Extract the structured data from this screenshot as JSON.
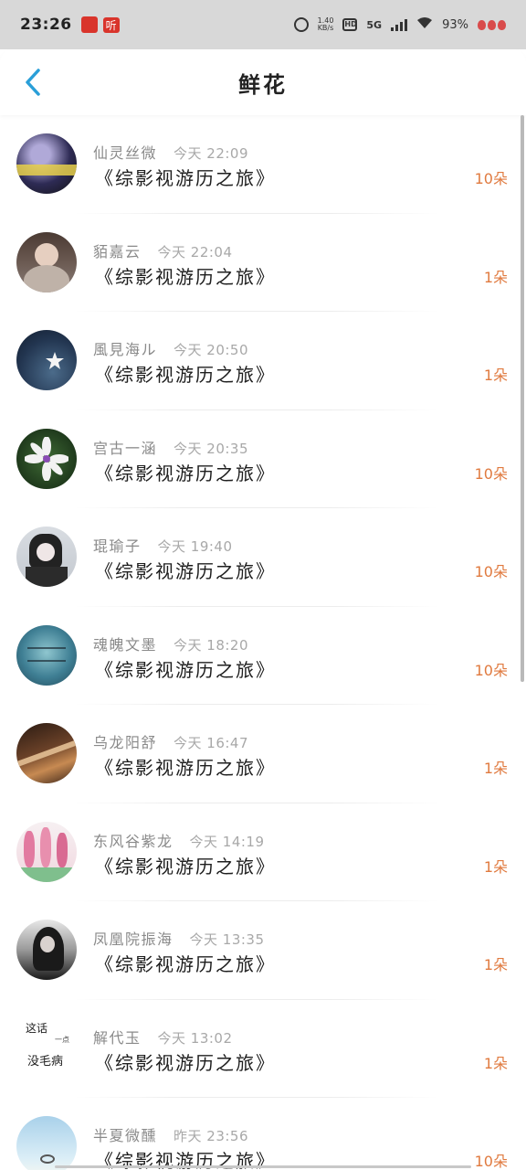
{
  "status_bar": {
    "time": "23:26",
    "app_badge": "听",
    "net_speed": "1.40",
    "net_speed_unit": "KB/s",
    "hd_label": "HD",
    "network": "5G",
    "battery": "93%"
  },
  "header": {
    "title": "鲜花"
  },
  "list": [
    {
      "user": "仙灵丝微",
      "time": "今天 22:09",
      "title": "《综影视游历之旅》",
      "count": "10朵"
    },
    {
      "user": "貊嘉云",
      "time": "今天 22:04",
      "title": "《综影视游历之旅》",
      "count": "1朵"
    },
    {
      "user": "風見海ル",
      "time": "今天 20:50",
      "title": "《综影视游历之旅》",
      "count": "1朵"
    },
    {
      "user": "宫古一涵",
      "time": "今天 20:35",
      "title": "《综影视游历之旅》",
      "count": "10朵"
    },
    {
      "user": "琨瑜子",
      "time": "今天 19:40",
      "title": "《综影视游历之旅》",
      "count": "10朵"
    },
    {
      "user": "魂魄文墨",
      "time": "今天 18:20",
      "title": "《综影视游历之旅》",
      "count": "10朵"
    },
    {
      "user": "乌龙阳舒",
      "time": "今天 16:47",
      "title": "《综影视游历之旅》",
      "count": "1朵"
    },
    {
      "user": "东风谷紫龙",
      "time": "今天 14:19",
      "title": "《综影视游历之旅》",
      "count": "1朵"
    },
    {
      "user": "凤凰院振海",
      "time": "今天 13:35",
      "title": "《综影视游历之旅》",
      "count": "1朵"
    },
    {
      "user": "解代玉",
      "time": "今天 13:02",
      "title": "《综影视游历之旅》",
      "count": "1朵"
    },
    {
      "user": "半夏微醺",
      "time": "昨天 23:56",
      "title": "《综影视游历之旅》",
      "count": "10朵"
    }
  ],
  "avatar_text": {
    "row10_line1": "这话",
    "row10_line2": "一点",
    "row10_line3": "没毛病"
  },
  "colors": {
    "accent": "#2a9fd8",
    "count": "#e07a3f",
    "status_bar_bg": "#d8d8d8"
  }
}
